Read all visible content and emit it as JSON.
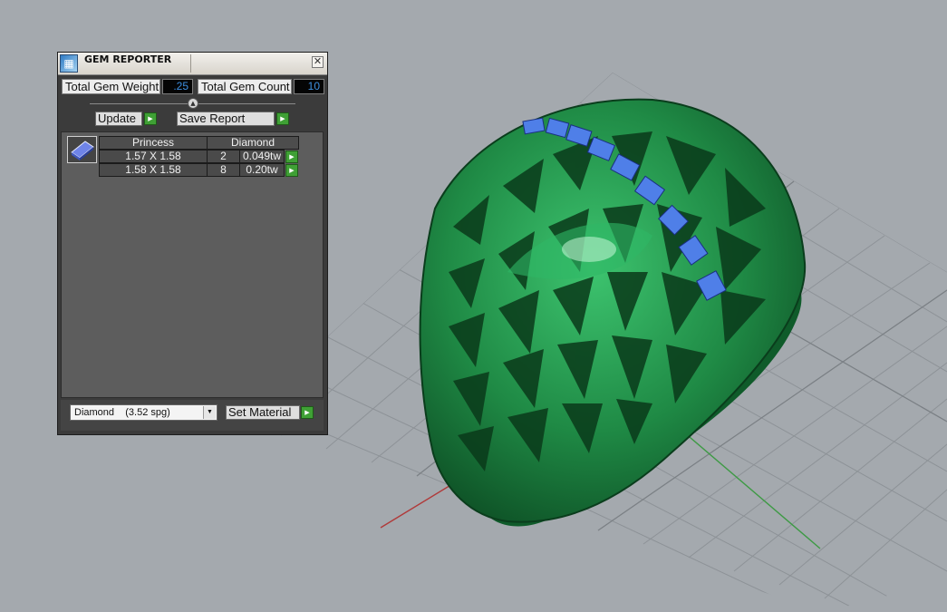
{
  "panel": {
    "title": "GEM REPORTER",
    "close_glyph": "✕",
    "icon": "gem-reporter-app-icon",
    "total_weight_label": "Total Gem Weight",
    "total_weight_value": ".25",
    "total_count_label": "Total Gem Count",
    "total_count_value": "10",
    "update_label": "Update",
    "save_report_label": "Save Report",
    "table": {
      "headers": [
        "Princess",
        "Diamond"
      ],
      "rows": [
        {
          "size": "1.57 X 1.58",
          "count": "2",
          "weight": "0.049tw"
        },
        {
          "size": "1.58 X 1.58",
          "count": "8",
          "weight": "0.20tw"
        }
      ]
    },
    "material_selected": "Diamond    (3.52 spg)",
    "set_material_label": "Set Material"
  },
  "colors": {
    "ring_green": "#1f8a45",
    "gem_blue": "#4f7fe8",
    "axis_red": "#b03a3a",
    "axis_green": "#3e9a45",
    "accent_blue_text": "#3d8fe0",
    "go_button_green": "#3fa035"
  }
}
